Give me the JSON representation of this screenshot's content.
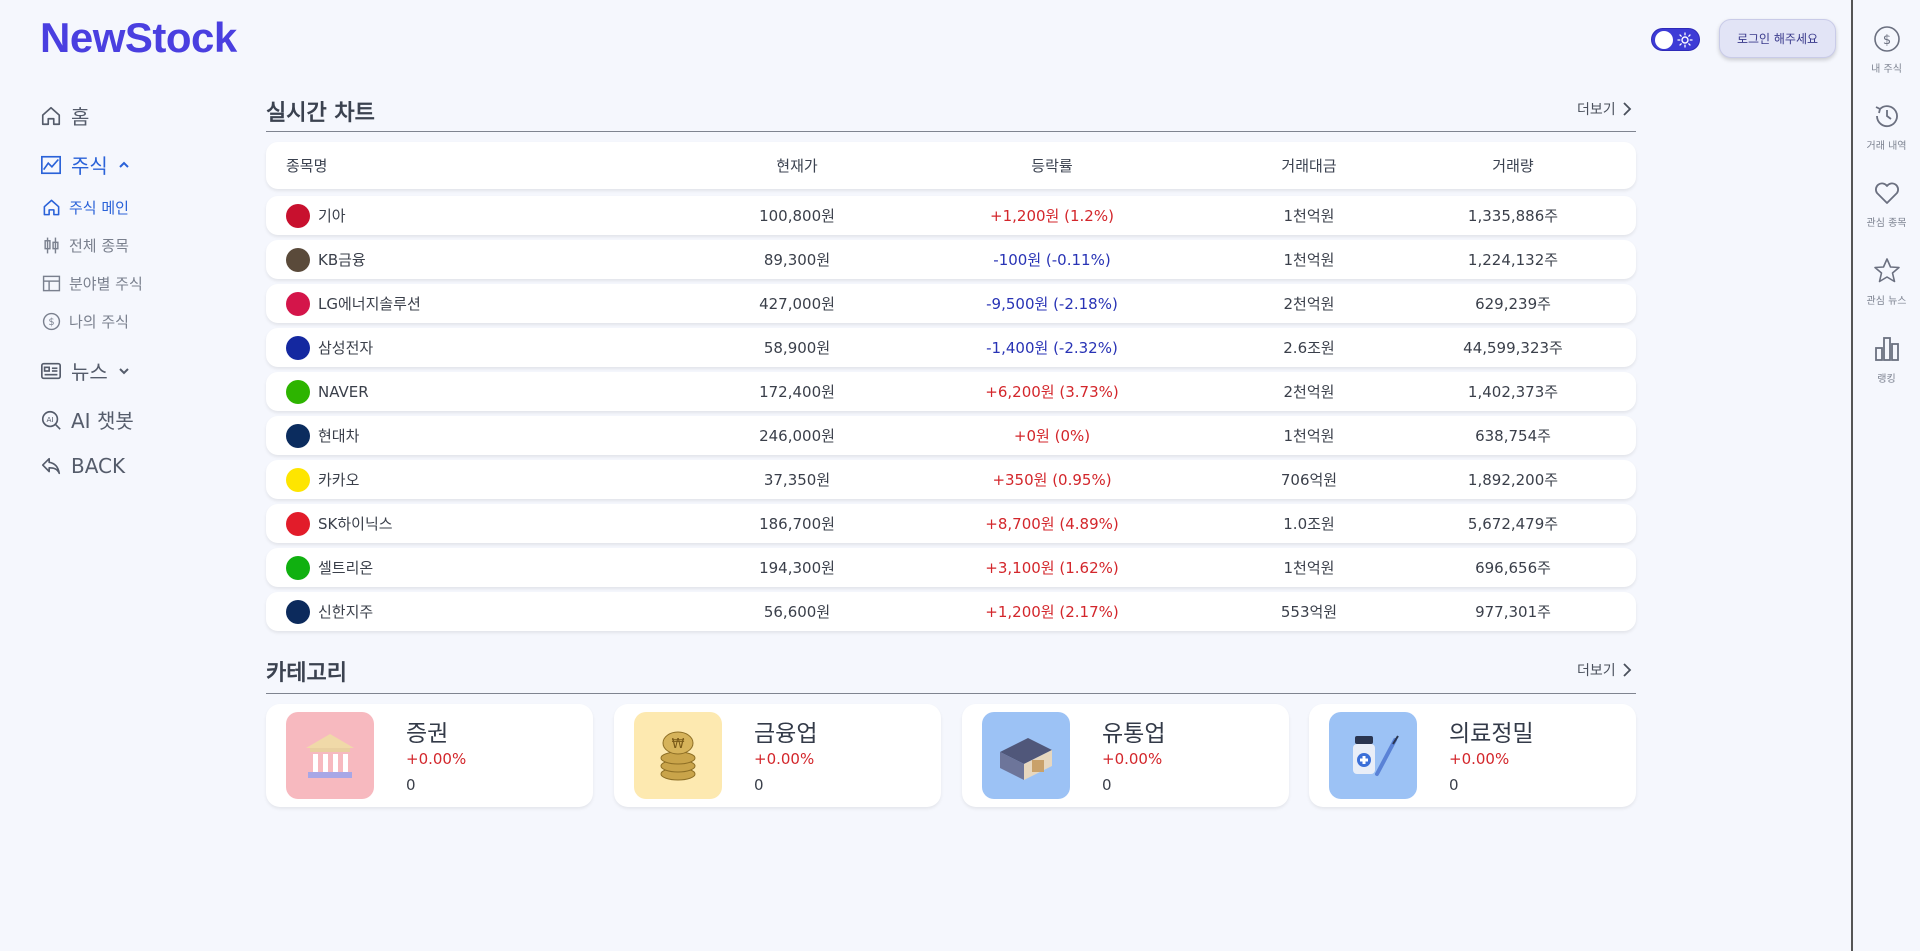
{
  "brand": "NewStock",
  "header": {
    "login_label": "로그인 해주세요"
  },
  "nav": {
    "home": "홈",
    "stock": "주식",
    "stock_sub": [
      "주식 메인",
      "전체 종목",
      "분야별 주식",
      "나의 주식"
    ],
    "news": "뉴스",
    "ai": "AI 챗봇",
    "back": "BACK"
  },
  "rail": [
    "내 주식",
    "거래 내역",
    "관심 종목",
    "관심 뉴스",
    "랭킹"
  ],
  "realtime": {
    "title": "실시간 차트",
    "more": "더보기",
    "columns": [
      "종목명",
      "현재가",
      "등락률",
      "거래대금",
      "거래량"
    ],
    "rows": [
      {
        "name": "기아",
        "price": "100,800원",
        "change": "+1,200원 (1.2%)",
        "dir": "up",
        "amount": "1천억원",
        "volume": "1,335,886주",
        "color": "#c8102e"
      },
      {
        "name": "KB금융",
        "price": "89,300원",
        "change": "-100원 (-0.11%)",
        "dir": "down",
        "amount": "1천억원",
        "volume": "1,224,132주",
        "color": "#5a4a3a"
      },
      {
        "name": "LG에너지솔루션",
        "price": "427,000원",
        "change": "-9,500원 (-2.18%)",
        "dir": "down",
        "amount": "2천억원",
        "volume": "629,239주",
        "color": "#d4154a"
      },
      {
        "name": "삼성전자",
        "price": "58,900원",
        "change": "-1,400원 (-2.32%)",
        "dir": "down",
        "amount": "2.6조원",
        "volume": "44,599,323주",
        "color": "#1428a0"
      },
      {
        "name": "NAVER",
        "price": "172,400원",
        "change": "+6,200원 (3.73%)",
        "dir": "up",
        "amount": "2천억원",
        "volume": "1,402,373주",
        "color": "#2db400"
      },
      {
        "name": "현대차",
        "price": "246,000원",
        "change": "+0원 (0%)",
        "dir": "up",
        "amount": "1천억원",
        "volume": "638,754주",
        "color": "#0b2c5e"
      },
      {
        "name": "카카오",
        "price": "37,350원",
        "change": "+350원 (0.95%)",
        "dir": "up",
        "amount": "706억원",
        "volume": "1,892,200주",
        "color": "#fee500"
      },
      {
        "name": "SK하이닉스",
        "price": "186,700원",
        "change": "+8,700원 (4.89%)",
        "dir": "up",
        "amount": "1.0조원",
        "volume": "5,672,479주",
        "color": "#e21c2a"
      },
      {
        "name": "셀트리온",
        "price": "194,300원",
        "change": "+3,100원 (1.62%)",
        "dir": "up",
        "amount": "1천억원",
        "volume": "696,656주",
        "color": "#10b010"
      },
      {
        "name": "신한지주",
        "price": "56,600원",
        "change": "+1,200원 (2.17%)",
        "dir": "up",
        "amount": "553억원",
        "volume": "977,301주",
        "color": "#0c2a5c"
      }
    ]
  },
  "category": {
    "title": "카테고리",
    "more": "더보기",
    "items": [
      {
        "name": "증권",
        "rate": "+0.00%",
        "count": "0",
        "bg": "#f7b9bf"
      },
      {
        "name": "금융업",
        "rate": "+0.00%",
        "count": "0",
        "bg": "#fde9b0"
      },
      {
        "name": "유통업",
        "rate": "+0.00%",
        "count": "0",
        "bg": "#9cc2f5"
      },
      {
        "name": "의료정밀",
        "rate": "+0.00%",
        "count": "0",
        "bg": "#9cc2f5"
      }
    ]
  }
}
